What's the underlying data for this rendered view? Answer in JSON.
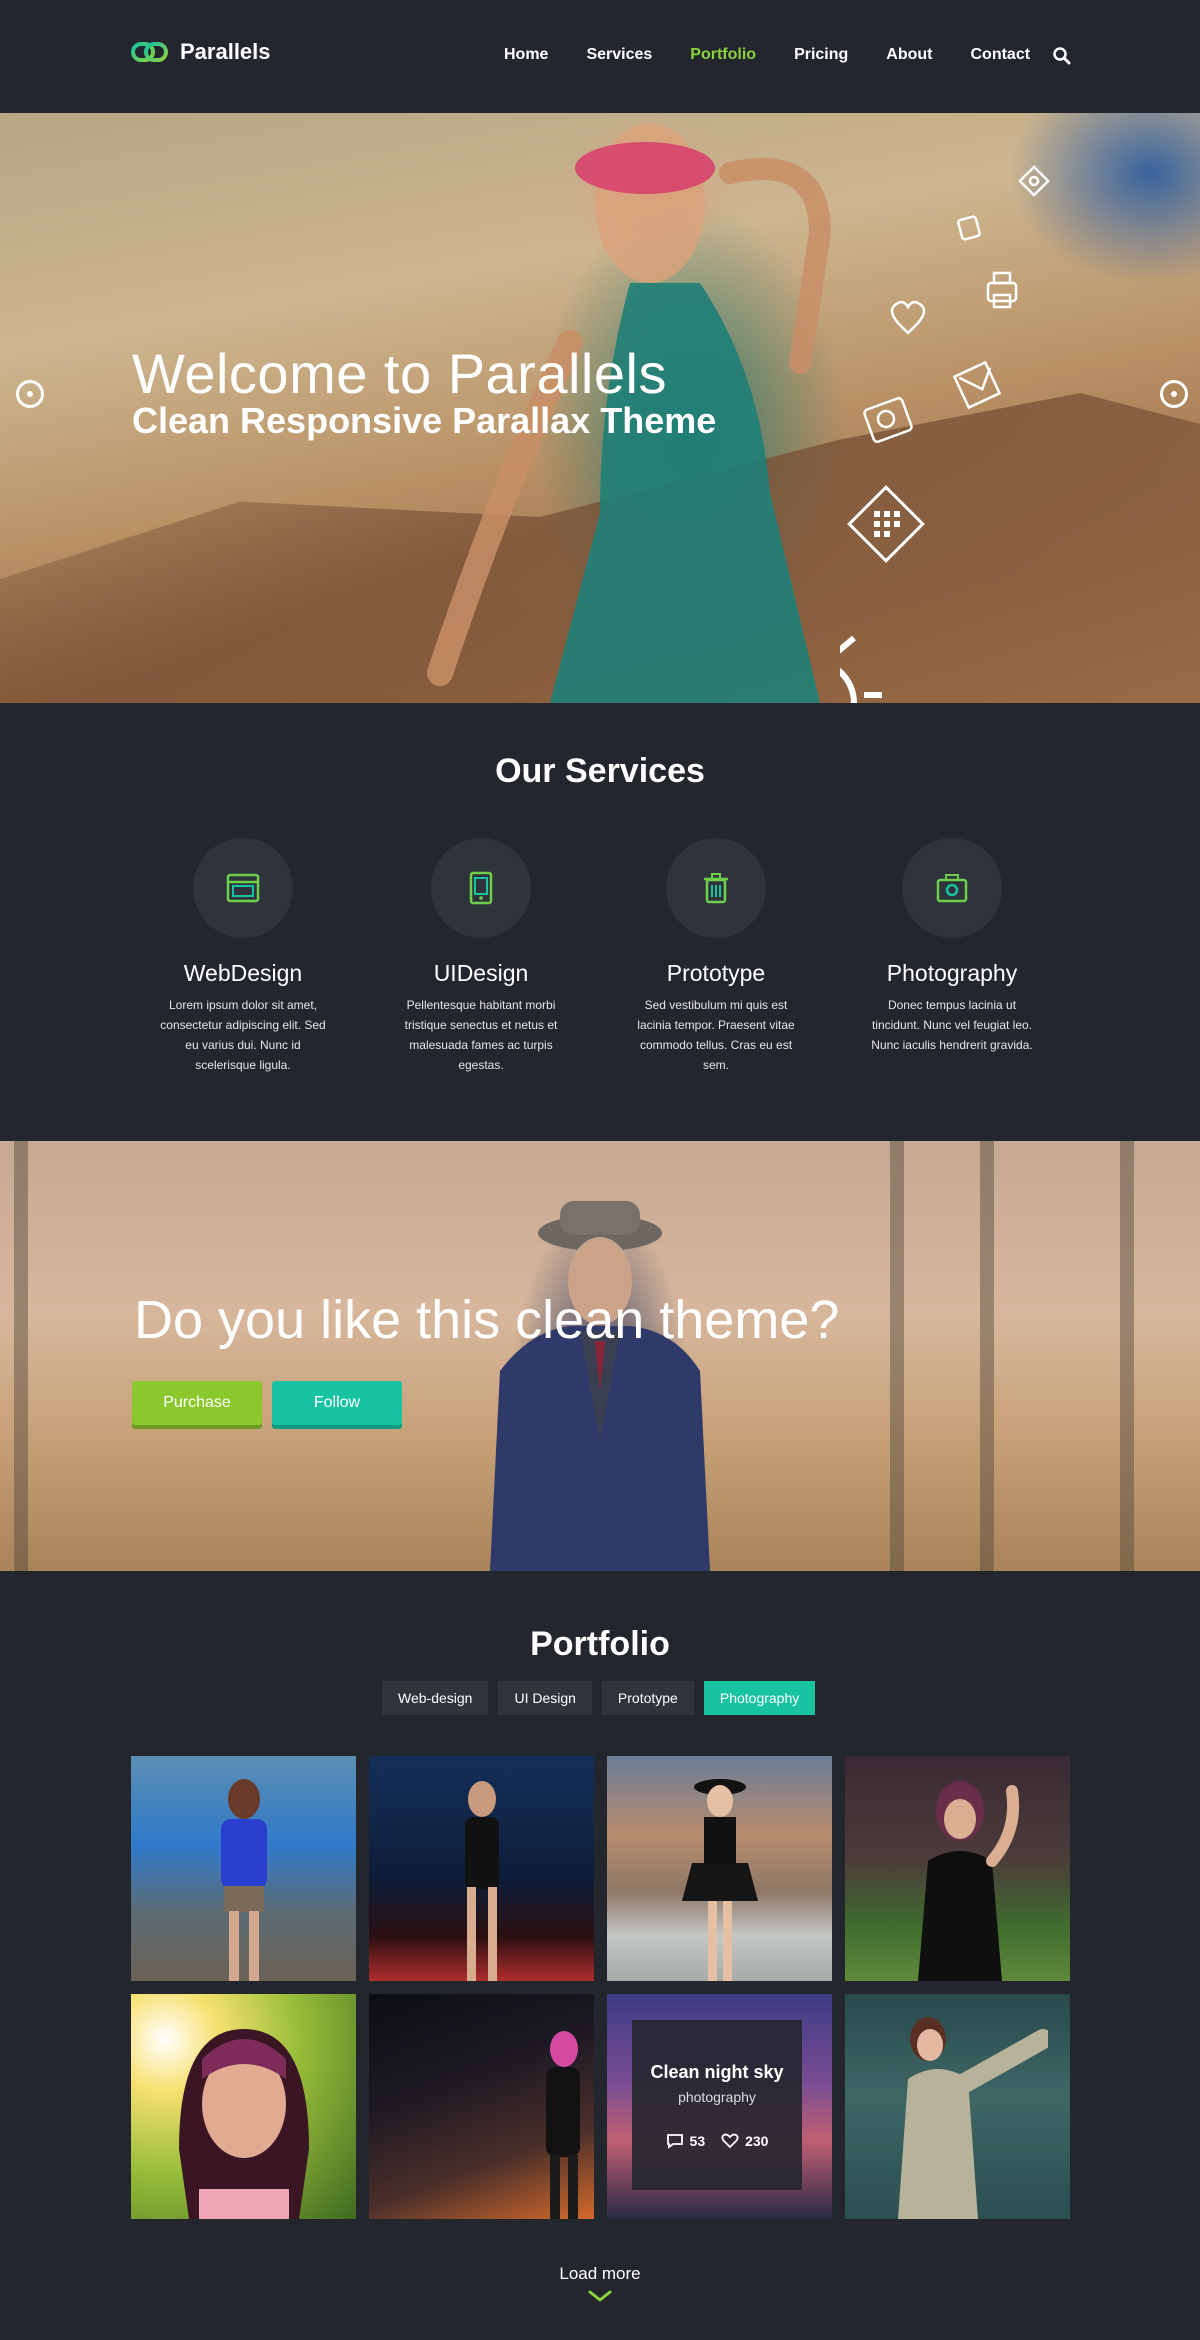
{
  "header": {
    "brand": "Parallels",
    "nav": [
      "Home",
      "Services",
      "Portfolio",
      "Pricing",
      "About",
      "Contact"
    ],
    "active_nav": "Portfolio",
    "search_icon": "search-icon"
  },
  "colors": {
    "background": "#23262d",
    "accent_green": "#8bd23e",
    "accent_teal": "#17c3a1",
    "purchase_button": "#8bc82d"
  },
  "hero": {
    "title": "Welcome to Parallels",
    "subtitle": "Clean Responsive Parallax Theme",
    "icons": [
      "settings-icon",
      "badge-icon",
      "printer-icon",
      "heart-icon",
      "mail-icon",
      "camera-icon",
      "calendar-icon",
      "sun-icon"
    ]
  },
  "services": {
    "title": "Our Services",
    "items": [
      {
        "title": "WebDesign",
        "icon": "browser-icon",
        "text": "Lorem ipsum dolor sit amet, consectetur adipiscing elit. Sed eu varius dui. Nunc id scelerisque ligula."
      },
      {
        "title": "UIDesign",
        "icon": "mobile-icon",
        "text": "Pellentesque habitant morbi tristique senectus et netus et malesuada fames ac turpis egestas."
      },
      {
        "title": "Prototype",
        "icon": "trash-icon",
        "text": "Sed vestibulum mi quis est lacinia tempor. Praesent vitae commodo tellus. Cras eu est sem."
      },
      {
        "title": "Photography",
        "icon": "camera-icon",
        "text": "Donec tempus lacinia ut tincidunt. Nunc vel feugiat leo. Nunc iaculis hendrerit gravida."
      }
    ]
  },
  "cta": {
    "title": "Do you like this clean theme?",
    "purchase_label": "Purchase",
    "follow_label": "Follow"
  },
  "portfolio": {
    "title": "Portfolio",
    "filters": [
      "Web-design",
      "UI Design",
      "Prototype",
      "Photography"
    ],
    "active_filter": "Photography",
    "overlay": {
      "title": "Clean night sky",
      "category": "photography",
      "comments": "53",
      "likes": "230"
    },
    "load_more": "Load more"
  }
}
